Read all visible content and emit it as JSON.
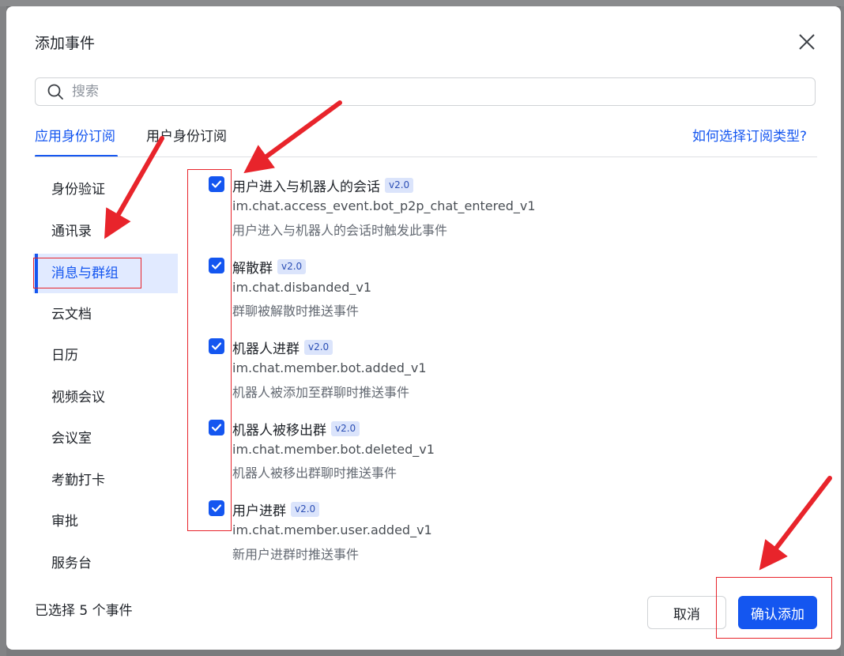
{
  "dialog": {
    "title": "添加事件",
    "search_placeholder": "搜索",
    "tabs": [
      {
        "label": "应用身份订阅",
        "active": true
      },
      {
        "label": "用户身份订阅",
        "active": false
      }
    ],
    "help_link": "如何选择订阅类型?",
    "categories": [
      {
        "label": "身份验证"
      },
      {
        "label": "通讯录"
      },
      {
        "label": "消息与群组",
        "active": true
      },
      {
        "label": "云文档"
      },
      {
        "label": "日历"
      },
      {
        "label": "视频会议"
      },
      {
        "label": "会议室"
      },
      {
        "label": "考勤打卡"
      },
      {
        "label": "审批"
      },
      {
        "label": "服务台"
      }
    ],
    "events": [
      {
        "title": "用户进入与机器人的会话",
        "version": "v2.0",
        "key": "im.chat.access_event.bot_p2p_chat_entered_v1",
        "desc": "用户进入与机器人的会话时触发此事件",
        "checked": true
      },
      {
        "title": "解散群",
        "version": "v2.0",
        "key": "im.chat.disbanded_v1",
        "desc": "群聊被解散时推送事件",
        "checked": true
      },
      {
        "title": "机器人进群",
        "version": "v2.0",
        "key": "im.chat.member.bot.added_v1",
        "desc": "机器人被添加至群聊时推送事件",
        "checked": true
      },
      {
        "title": "机器人被移出群",
        "version": "v2.0",
        "key": "im.chat.member.bot.deleted_v1",
        "desc": "机器人被移出群聊时推送事件",
        "checked": true
      },
      {
        "title": "用户进群",
        "version": "v2.0",
        "key": "im.chat.member.user.added_v1",
        "desc": "新用户进群时推送事件",
        "checked": true
      }
    ],
    "selected_count": "已选择 5 个事件",
    "cancel_label": "取消",
    "confirm_label": "确认添加"
  },
  "colors": {
    "accent": "#1456f0",
    "annotation": "#e8242b",
    "active_bg": "#e1eaff"
  }
}
